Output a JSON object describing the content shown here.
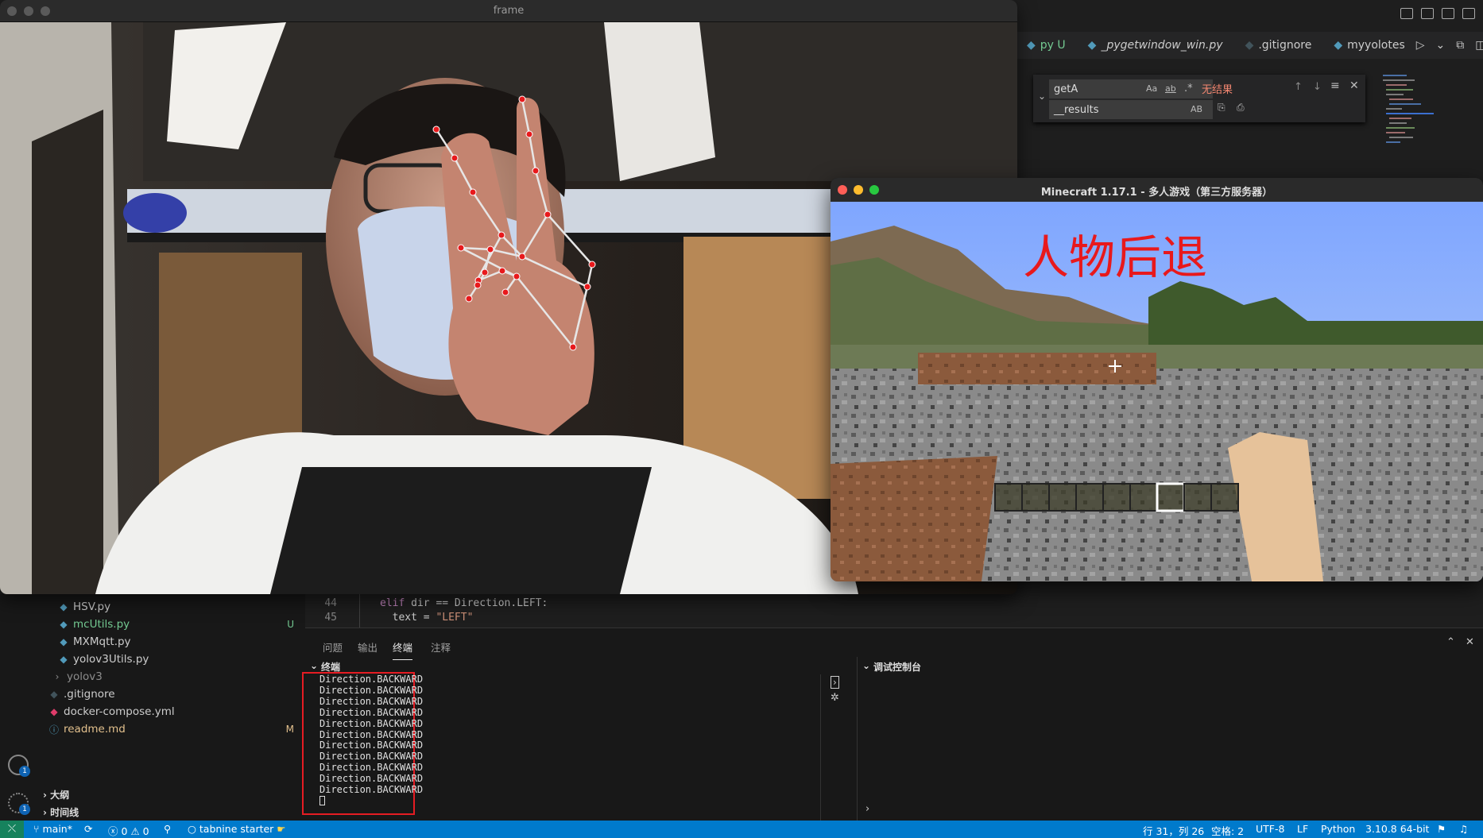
{
  "vscode": {
    "tabs": [
      {
        "label": "py U",
        "icon": "python-icon"
      },
      {
        "label": "_pygetwindow_win.py",
        "icon": "python-icon",
        "italic": true
      },
      {
        "label": ".gitignore",
        "icon": "gitignore-icon"
      },
      {
        "label": "myyolotes",
        "icon": "python-icon"
      }
    ],
    "find": {
      "search_value": "getA",
      "replace_value": "__results",
      "match_case": "Aa",
      "whole_word": "ab",
      "regex": ".*",
      "preserve_case": "AB",
      "no_results": "无结果"
    },
    "explorer": {
      "items": [
        {
          "name": "HSV.py",
          "icon": "python-icon",
          "color": "#cccccc",
          "badge": ""
        },
        {
          "name": "mcUtils.py",
          "icon": "python-icon",
          "color": "#73c991",
          "badge": "U"
        },
        {
          "name": "MXMqtt.py",
          "icon": "python-icon",
          "color": "#cccccc",
          "badge": ""
        },
        {
          "name": "yolov3Utils.py",
          "icon": "python-icon",
          "color": "#cccccc",
          "badge": ""
        },
        {
          "name": "yolov3",
          "icon": "chevron-right-icon",
          "color": "#8c8c8c",
          "badge": ""
        },
        {
          "name": ".gitignore",
          "icon": "gitignore-icon",
          "color": "#cccccc",
          "badge": ""
        },
        {
          "name": "docker-compose.yml",
          "icon": "docker-icon",
          "color": "#cccccc",
          "badge": ""
        },
        {
          "name": "readme.md",
          "icon": "info-icon",
          "color": "#e2c08d",
          "badge": "M"
        }
      ],
      "outline": "大纲",
      "timeline": "时间线"
    },
    "activity_badges": {
      "accounts": "1",
      "settings": "1"
    },
    "editor": {
      "lines": [
        {
          "num": "44",
          "kw": "elif",
          "rest": " dir == Direction.LEFT:"
        },
        {
          "num": "45",
          "kw": "",
          "rest": "  text = ",
          "str": "\"LEFT\""
        }
      ]
    },
    "panel": {
      "tabs": [
        "问题",
        "输出",
        "终端",
        "注释"
      ],
      "active_tab": "终端",
      "terminal_title": "终端",
      "debug_title": "调试控制台",
      "terminal_lines": [
        "Direction.BACKWARD",
        "Direction.BACKWARD",
        "Direction.BACKWARD",
        "Direction.BACKWARD",
        "Direction.BACKWARD",
        "Direction.BACKWARD",
        "Direction.BACKWARD",
        "Direction.BACKWARD",
        "Direction.BACKWARD",
        "Direction.BACKWARD",
        "Direction.BACKWARD"
      ]
    },
    "status": {
      "branch": "main*",
      "errors": "0",
      "warnings": "0",
      "tabnine": "tabnine starter",
      "position": "行 31，列 26",
      "spaces": "空格: 2",
      "encoding": "UTF-8",
      "eol": "LF",
      "language": "Python",
      "interpreter": "3.10.8 64-bit"
    }
  },
  "frame_window": {
    "title": "frame"
  },
  "minecraft_window": {
    "title": "Minecraft 1.17.1 - 多人游戏（第三方服务器）",
    "overlay_text": "人物后退",
    "overlay_color": "#e8191c",
    "hotbar_slots": 9,
    "selected_slot": 7
  },
  "colors": {
    "accent": "#007acc",
    "remote": "#16825d",
    "highlight_box": "#e51c23"
  }
}
